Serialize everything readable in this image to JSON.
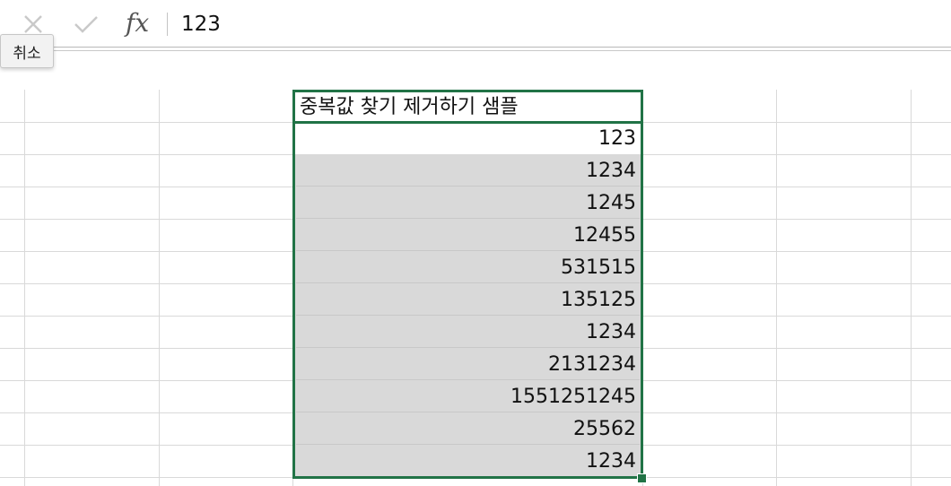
{
  "formula_bar": {
    "cancel_icon": "x-icon",
    "confirm_icon": "check-icon",
    "fx_label": "fx",
    "formula_value": "123",
    "tooltip": "취소"
  },
  "sheet": {
    "header": "중복값 찾기 제거하기 샘플",
    "values": [
      "123",
      "1234",
      "1245",
      "12455",
      "531515",
      "135125",
      "1234",
      "2131234",
      "1551251245",
      "25562",
      "1234"
    ]
  },
  "colors": {
    "selection": "#217346",
    "highlight_fill": "#d9d9d9",
    "gridline": "#d9d9d9"
  }
}
